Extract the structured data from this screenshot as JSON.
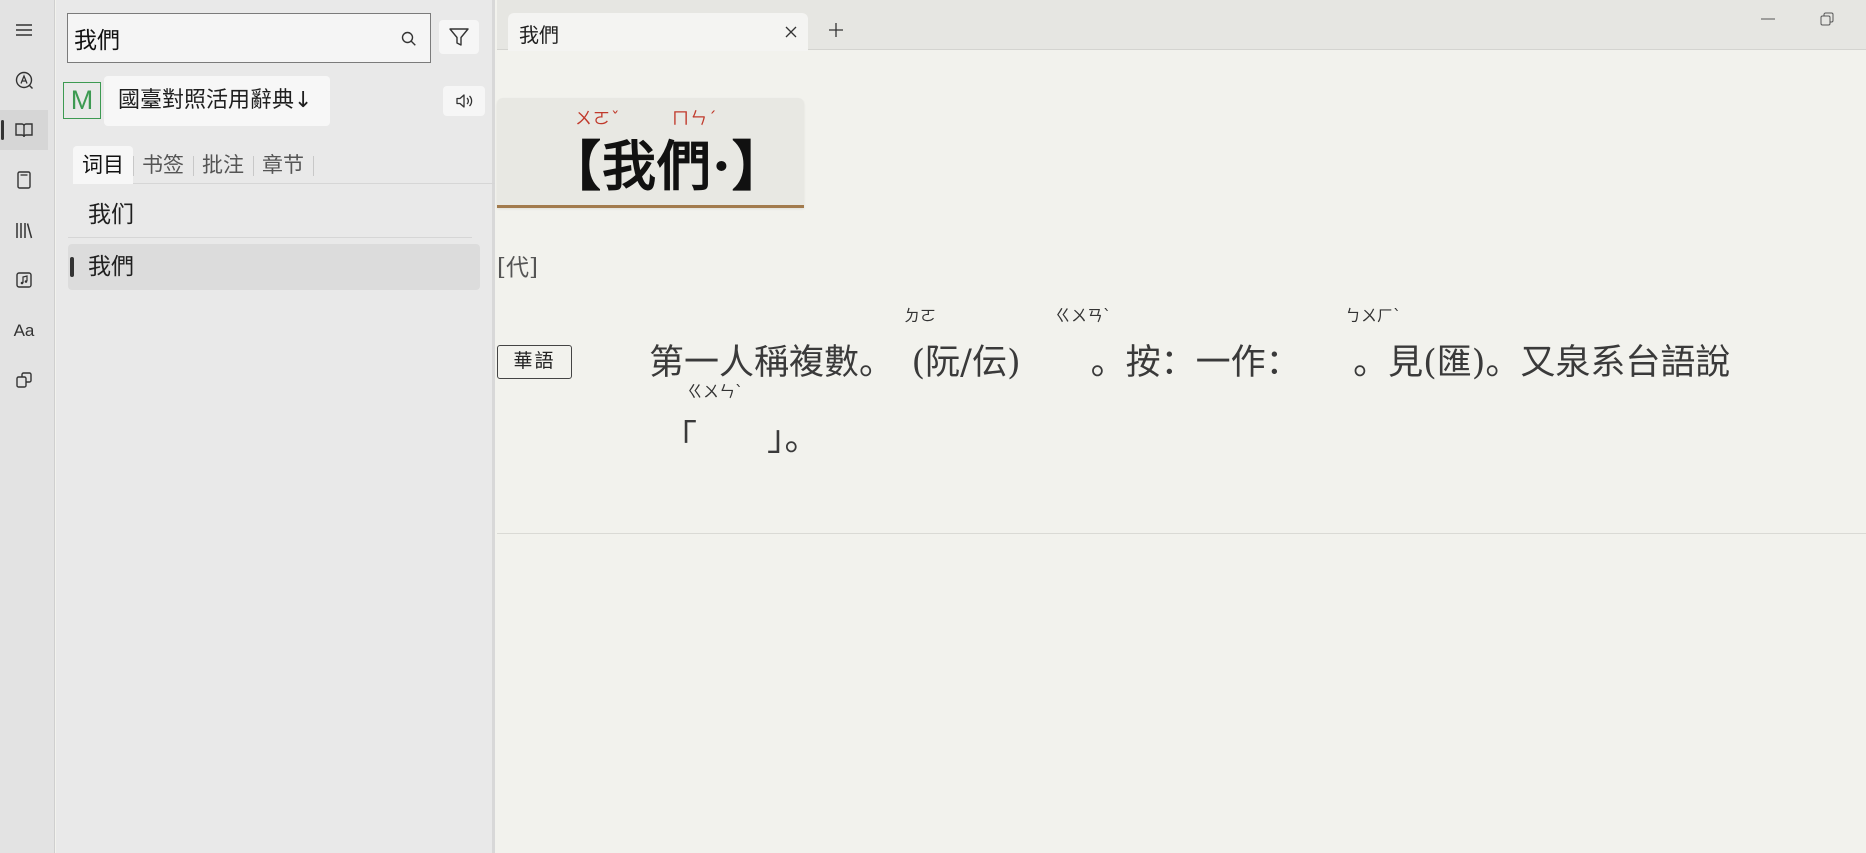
{
  "activity_bar": {
    "items": [
      {
        "name": "menu-icon"
      },
      {
        "name": "lookup-icon"
      },
      {
        "name": "dictionary-icon"
      },
      {
        "name": "notebook-icon"
      },
      {
        "name": "library-icon"
      },
      {
        "name": "audio-icon"
      },
      {
        "name": "font-icon",
        "label": "Aa"
      },
      {
        "name": "sync-icon"
      }
    ],
    "active_index": 2
  },
  "search": {
    "value": "我們"
  },
  "dictionary": {
    "logo_letter": "M",
    "name": "國臺對照活用辭典↓"
  },
  "panel_tabs": [
    "词目",
    "书签",
    "批注",
    "章节"
  ],
  "words": [
    "我们",
    "我們"
  ],
  "document_tab": {
    "title": "我們"
  },
  "entry": {
    "headword": "【我們·】",
    "zhuyin_1": "ㄨㄛˇ",
    "zhuyin_2": "ㄇㄣˊ",
    "pos": "[代]",
    "lang_badge": "華語",
    "definition_line1": "第一人稱複數。　(阮/伝)　　。按：一作：　　。見(匯)。又泉系台語說",
    "definition_line2": "「　　」。",
    "ruby_1": "ㄉㄛ",
    "ruby_2": "ㄍㄨㄢˋ",
    "ruby_3": "ㄅㄨㄏˋ",
    "ruby_4": "ㄍㄨㄣˋ"
  },
  "colors": {
    "accent_red": "#c0392b",
    "logo_green": "#3d9a52",
    "card_border": "#a27b4d"
  }
}
